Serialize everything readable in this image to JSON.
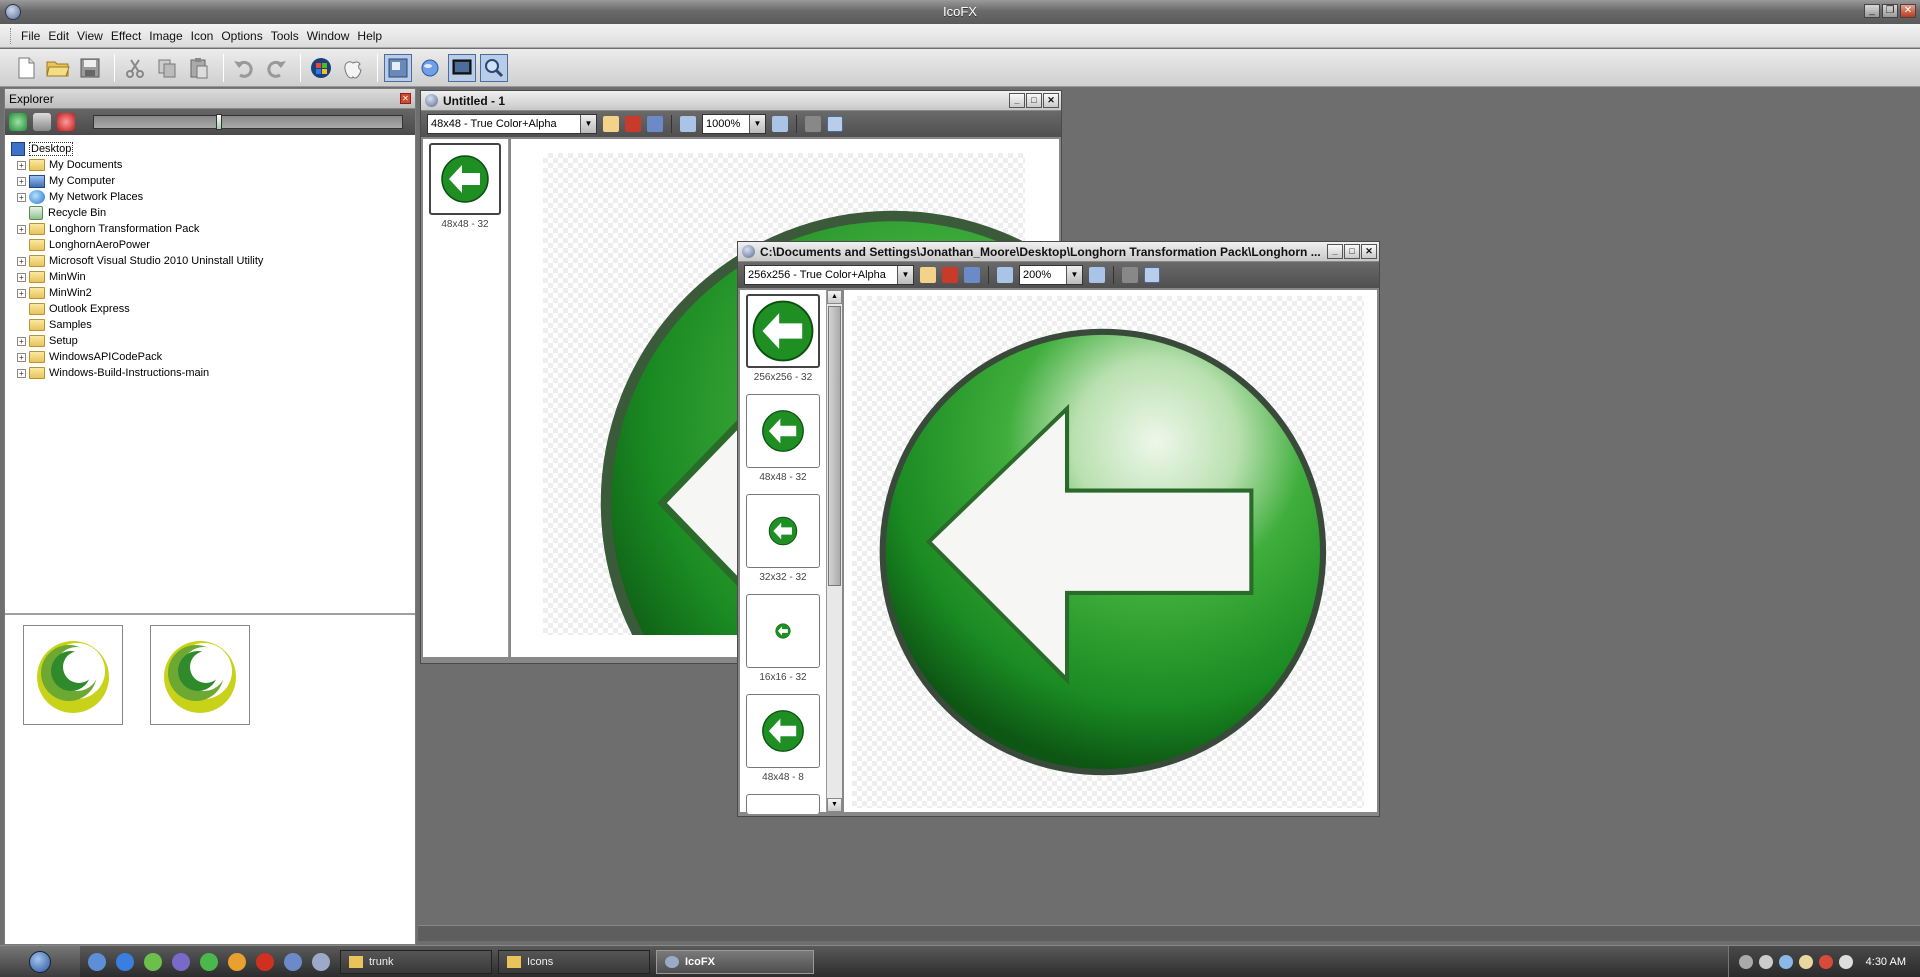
{
  "app": {
    "title": "IcoFX"
  },
  "menu": [
    "File",
    "Edit",
    "View",
    "Effect",
    "Image",
    "Icon",
    "Options",
    "Tools",
    "Window",
    "Help"
  ],
  "toolbar": {
    "icons": [
      "new-file-icon",
      "open-folder-icon",
      "save-icon",
      "cut-icon",
      "copy-icon",
      "paste-icon",
      "undo-icon",
      "redo-icon",
      "windows-logo-icon",
      "apple-logo-icon",
      "extract-icon",
      "globe-icon",
      "screen-capture-icon",
      "search-icon"
    ]
  },
  "explorer": {
    "title": "Explorer",
    "tree": [
      {
        "label": "Desktop",
        "icon": "desktop-icon",
        "level": 0,
        "expander": "",
        "selected": true
      },
      {
        "label": "My Documents",
        "icon": "folder-icon",
        "level": 1,
        "expander": "+"
      },
      {
        "label": "My Computer",
        "icon": "computer-icon",
        "level": 1,
        "expander": "+"
      },
      {
        "label": "My Network Places",
        "icon": "network-icon",
        "level": 1,
        "expander": "+"
      },
      {
        "label": "Recycle Bin",
        "icon": "recycle-bin-icon",
        "level": 1,
        "expander": ""
      },
      {
        "label": "Longhorn Transformation Pack",
        "icon": "folder-icon",
        "level": 1,
        "expander": "+"
      },
      {
        "label": "LonghornAeroPower",
        "icon": "folder-icon",
        "level": 1,
        "expander": ""
      },
      {
        "label": "Microsoft Visual Studio 2010 Uninstall Utility",
        "icon": "folder-icon",
        "level": 1,
        "expander": "+"
      },
      {
        "label": "MinWin",
        "icon": "folder-icon",
        "level": 1,
        "expander": "+"
      },
      {
        "label": "MinWin2",
        "icon": "folder-icon",
        "level": 1,
        "expander": "+"
      },
      {
        "label": "Outlook Express",
        "icon": "folder-icon",
        "level": 1,
        "expander": ""
      },
      {
        "label": "Samples",
        "icon": "folder-icon",
        "level": 1,
        "expander": ""
      },
      {
        "label": "Setup",
        "icon": "folder-icon",
        "level": 1,
        "expander": "+"
      },
      {
        "label": "WindowsAPICodePack",
        "icon": "folder-icon",
        "level": 1,
        "expander": "+"
      },
      {
        "label": "Windows-Build-Instructions-main",
        "icon": "folder-icon",
        "level": 1,
        "expander": "+"
      }
    ],
    "slider_value": 0.4
  },
  "window1": {
    "title": "Untitled - 1",
    "format": "48x48 - True Color+Alpha",
    "zoom": "1000%",
    "frames": [
      {
        "label": "48x48 - 32"
      }
    ]
  },
  "window2": {
    "title": "C:\\Documents and Settings\\Jonathan_Moore\\Desktop\\Longhorn Transformation Pack\\Longhorn ...",
    "format": "256x256 - True Color+Alpha",
    "zoom": "200%",
    "frames": [
      {
        "label": "256x256 - 32"
      },
      {
        "label": "48x48 - 32"
      },
      {
        "label": "32x32 - 32"
      },
      {
        "label": "16x16 - 32"
      },
      {
        "label": "48x48 - 8"
      }
    ]
  },
  "taskbar": {
    "tasks": [
      {
        "label": "trunk",
        "icon": "folder-icon"
      },
      {
        "label": "Icons",
        "icon": "folder-icon"
      },
      {
        "label": "IcoFX",
        "icon": "icofx-icon",
        "active": true
      }
    ],
    "clock": "4:30 AM"
  },
  "colors": {
    "green": "#2ea12e",
    "dark_green": "#0f6a1a",
    "gray_bg": "#6e6e6e"
  }
}
